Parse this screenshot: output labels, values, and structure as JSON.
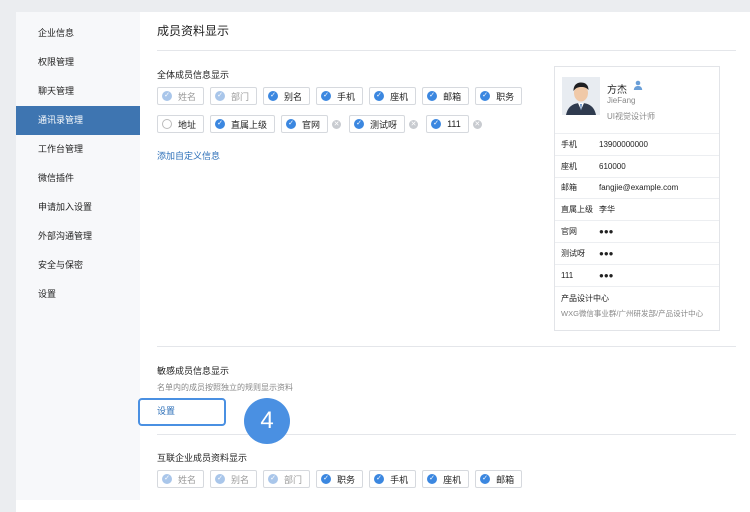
{
  "sidebar": {
    "items": [
      {
        "label": "企业信息"
      },
      {
        "label": "权限管理"
      },
      {
        "label": "聊天管理"
      },
      {
        "label": "通讯录管理",
        "active": true
      },
      {
        "label": "工作台管理"
      },
      {
        "label": "微信插件"
      },
      {
        "label": "申请加入设置"
      },
      {
        "label": "外部沟通管理"
      },
      {
        "label": "安全与保密"
      },
      {
        "label": "设置"
      }
    ]
  },
  "main": {
    "title": "成员资料显示",
    "all_members": {
      "title": "全体成员信息显示",
      "row1": [
        {
          "label": "姓名",
          "state": "disabled"
        },
        {
          "label": "部门",
          "state": "disabled"
        },
        {
          "label": "别名",
          "state": "on"
        },
        {
          "label": "手机",
          "state": "on"
        },
        {
          "label": "座机",
          "state": "on"
        },
        {
          "label": "邮箱",
          "state": "on"
        },
        {
          "label": "职务",
          "state": "on"
        }
      ],
      "row2": [
        {
          "label": "地址",
          "state": "empty"
        },
        {
          "label": "直属上级",
          "state": "on"
        },
        {
          "label": "官网",
          "state": "on",
          "removable": true
        },
        {
          "label": "测试呀",
          "state": "on",
          "removable": true
        },
        {
          "label": "111",
          "state": "on",
          "removable": true
        }
      ],
      "add_link": "添加自定义信息"
    },
    "sensitive": {
      "title": "敏感成员信息显示",
      "desc": "名单内的成员按照独立的规则显示资料",
      "setting_link": "设置"
    },
    "interconnect": {
      "title": "互联企业成员资料显示",
      "row1": [
        {
          "label": "姓名",
          "state": "disabled"
        },
        {
          "label": "别名",
          "state": "disabled"
        },
        {
          "label": "部门",
          "state": "disabled"
        },
        {
          "label": "职务",
          "state": "on"
        },
        {
          "label": "手机",
          "state": "on"
        },
        {
          "label": "座机",
          "state": "on"
        },
        {
          "label": "邮箱",
          "state": "on"
        }
      ]
    },
    "step_badge": "4"
  },
  "card": {
    "name": "方杰",
    "english_name": "JieFang",
    "role": "UI视觉设计师",
    "rows": [
      {
        "key": "手机",
        "value": "13900000000"
      },
      {
        "key": "座机",
        "value": "610000"
      },
      {
        "key": "邮箱",
        "value": "fangjie@example.com"
      },
      {
        "key": "直属上级",
        "value": "李华"
      },
      {
        "key": "官网",
        "value": "●●●"
      },
      {
        "key": "测试呀",
        "value": "●●●"
      },
      {
        "key": "111",
        "value": "●●●"
      }
    ],
    "dept": "产品设计中心",
    "dept_path": "WXG微信事业群/广州研发部/产品设计中心"
  },
  "colors": {
    "accent": "#3b87e0",
    "sidebar_active": "#3e75b1",
    "link": "#2c6fb8"
  }
}
